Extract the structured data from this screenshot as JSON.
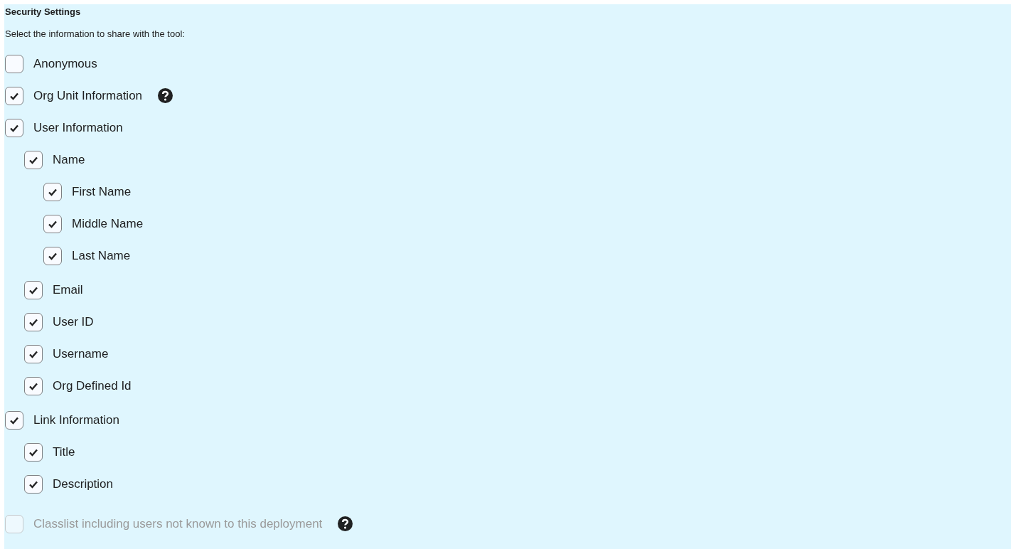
{
  "section": {
    "title": "Security Settings",
    "instruction": "Select the information to share with the tool:"
  },
  "options": [
    {
      "label": "Anonymous",
      "checked": false,
      "disabled": false,
      "help": false
    },
    {
      "label": "Org Unit Information",
      "checked": true,
      "disabled": false,
      "help": true
    },
    {
      "label": "User Information",
      "checked": true,
      "disabled": false,
      "help": false,
      "children": [
        {
          "label": "Name",
          "checked": true,
          "disabled": false,
          "help": false,
          "children": [
            {
              "label": "First Name",
              "checked": true,
              "disabled": false,
              "help": false
            },
            {
              "label": "Middle Name",
              "checked": true,
              "disabled": false,
              "help": false
            },
            {
              "label": "Last Name",
              "checked": true,
              "disabled": false,
              "help": false
            }
          ]
        },
        {
          "label": "Email",
          "checked": true,
          "disabled": false,
          "help": false
        },
        {
          "label": "User ID",
          "checked": true,
          "disabled": false,
          "help": false
        },
        {
          "label": "Username",
          "checked": true,
          "disabled": false,
          "help": false
        },
        {
          "label": "Org Defined Id",
          "checked": true,
          "disabled": false,
          "help": false
        }
      ]
    },
    {
      "label": "Link Information",
      "checked": true,
      "disabled": false,
      "help": false,
      "children": [
        {
          "label": "Title",
          "checked": true,
          "disabled": false,
          "help": false
        },
        {
          "label": "Description",
          "checked": true,
          "disabled": false,
          "help": false
        }
      ]
    },
    {
      "label": "Classlist including users not known to this deployment",
      "checked": false,
      "disabled": true,
      "help": true
    }
  ]
}
